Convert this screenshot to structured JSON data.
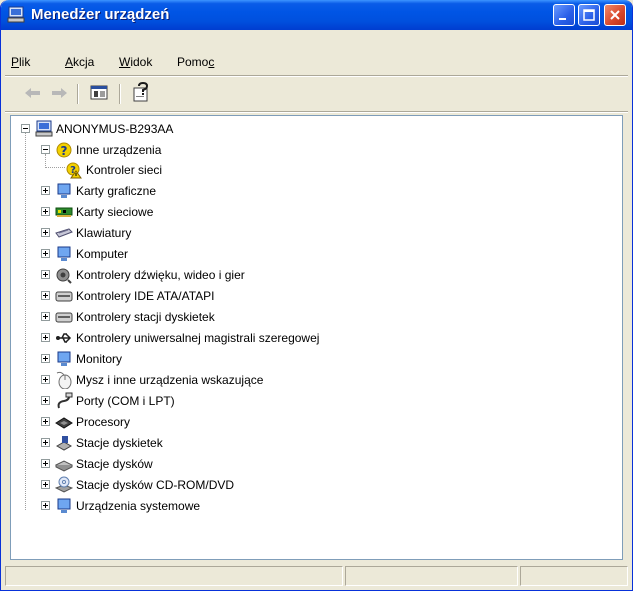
{
  "window": {
    "title": "Menedżer urządzeń"
  },
  "menu": [
    {
      "mnemonic": "P",
      "rest": "lik"
    },
    {
      "mnemonic": "A",
      "rest": "kcja"
    },
    {
      "mnemonic": "W",
      "rest": "idok"
    },
    {
      "prefix": "Pomo",
      "mnemonic": "c"
    }
  ],
  "toolbar": {
    "icons": [
      "back-arrow-icon",
      "forward-arrow-icon",
      "properties-panel-icon",
      "help-properties-icon"
    ]
  },
  "tree": {
    "root": "ANONYMUS-B293AA",
    "open_category": "Inne urządzenia",
    "open_child": "Kontroler sieci",
    "categories": [
      "Karty graficzne",
      "Karty sieciowe",
      "Klawiatury",
      "Komputer",
      "Kontrolery dźwięku, wideo i gier",
      "Kontrolery IDE ATA/ATAPI",
      "Kontrolery stacji dyskietek",
      "Kontrolery uniwersalnej magistrali szeregowej",
      "Monitory",
      "Mysz i inne urządzenia wskazujące",
      "Porty (COM i LPT)",
      "Procesory",
      "Stacje dyskietek",
      "Stacje dysków",
      "Stacje dysków CD-ROM/DVD",
      "Urządzenia systemowe"
    ]
  },
  "colors": {
    "title_bar": "#0055E5",
    "close_button": "#D8462A",
    "window_bg": "#ECE9D8"
  }
}
